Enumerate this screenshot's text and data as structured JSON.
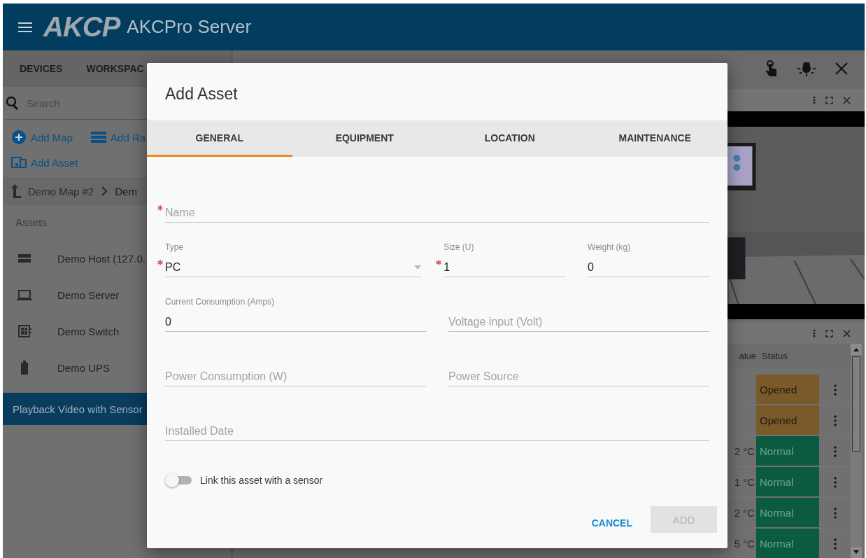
{
  "header": {
    "logo": "AKCP",
    "title": "AKCPro Server"
  },
  "sidebar": {
    "nav_tabs": [
      "DEVICES",
      "WORKSPAC"
    ],
    "search": {
      "placeholder": "Search"
    },
    "actions": [
      {
        "kind": "add-map",
        "label": "Add Map"
      },
      {
        "kind": "add-rack",
        "label": "Add Ra"
      },
      {
        "kind": "add-asset",
        "label": "Add Asset"
      }
    ],
    "breadcrumb": [
      "Demo Map #2",
      "Dem"
    ],
    "assets_heading": "Assets",
    "assets": [
      {
        "kind": "host",
        "label": "Demo Host (127.0."
      },
      {
        "kind": "server",
        "label": "Demo Server"
      },
      {
        "kind": "switch",
        "label": "Demo Switch"
      },
      {
        "kind": "ups",
        "label": "Demo UPS"
      }
    ],
    "banner": "Playback Video with Sensor"
  },
  "sensor_table": {
    "columns": [
      "alue",
      "Status"
    ],
    "rows": [
      {
        "status": "Opened",
        "color": "#7a5a28"
      },
      {
        "status": "Opened",
        "color": "#7a5a28"
      },
      {
        "value": "2 °C",
        "status": "Normal",
        "color": "#0b5a42"
      },
      {
        "value": "1 °C",
        "status": "Normal",
        "color": "#0b5a42"
      },
      {
        "value": "2 °C",
        "status": "Normal",
        "color": "#0b5a42"
      },
      {
        "value": "5 °C",
        "status": "Normal",
        "color": "#0b5a42"
      }
    ]
  },
  "dialog": {
    "title": "Add Asset",
    "tabs": [
      {
        "label": "GENERAL",
        "selected": true
      },
      {
        "label": "EQUIPMENT",
        "selected": false
      },
      {
        "label": "LOCATION",
        "selected": false
      },
      {
        "label": "MAINTENANCE",
        "selected": false
      }
    ],
    "rows": [
      [
        {
          "kind": "text",
          "label": "Name",
          "required": true
        }
      ],
      [
        {
          "kind": "select",
          "label": "Type",
          "value": "PC",
          "required": true
        },
        {
          "kind": "text",
          "label": "Size (U)",
          "value": "1",
          "required": true
        },
        {
          "kind": "text",
          "label": "Weight (kg)",
          "value": "0",
          "required": false
        }
      ],
      [
        {
          "kind": "text",
          "label": "Current Consumption (Amps)",
          "value": "0",
          "required": false
        },
        {
          "kind": "text",
          "label": "Voltage input (Volt)",
          "required": false
        }
      ],
      [
        {
          "kind": "text",
          "label": "Power Consumption (W)",
          "required": false
        },
        {
          "kind": "text",
          "label": "Power Source",
          "required": false
        }
      ],
      [
        {
          "kind": "text",
          "label": "Installed Date",
          "required": false
        }
      ]
    ],
    "toggle": {
      "label": "Link this asset with a sensor",
      "on": false
    },
    "buttons": [
      {
        "kind": "text",
        "label": "CANCEL",
        "disabled": false
      },
      {
        "kind": "raised",
        "label": "ADD",
        "disabled": true
      }
    ]
  }
}
